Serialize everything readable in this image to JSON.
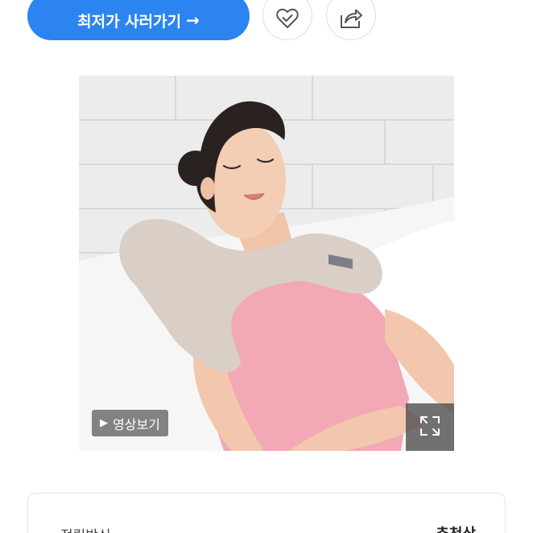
{
  "actions": {
    "buy_label": "최저가 사러가기",
    "buy_arrow": "→",
    "wish_icon": "heart-check-icon",
    "share_icon": "share-icon",
    "accent_color": "#2c84f0"
  },
  "product": {
    "video_label": "영상보기",
    "play_icon": "play-icon",
    "expand_icon": "expand-icon"
  },
  "info": {
    "label": "적립방식",
    "value": "추천상"
  }
}
